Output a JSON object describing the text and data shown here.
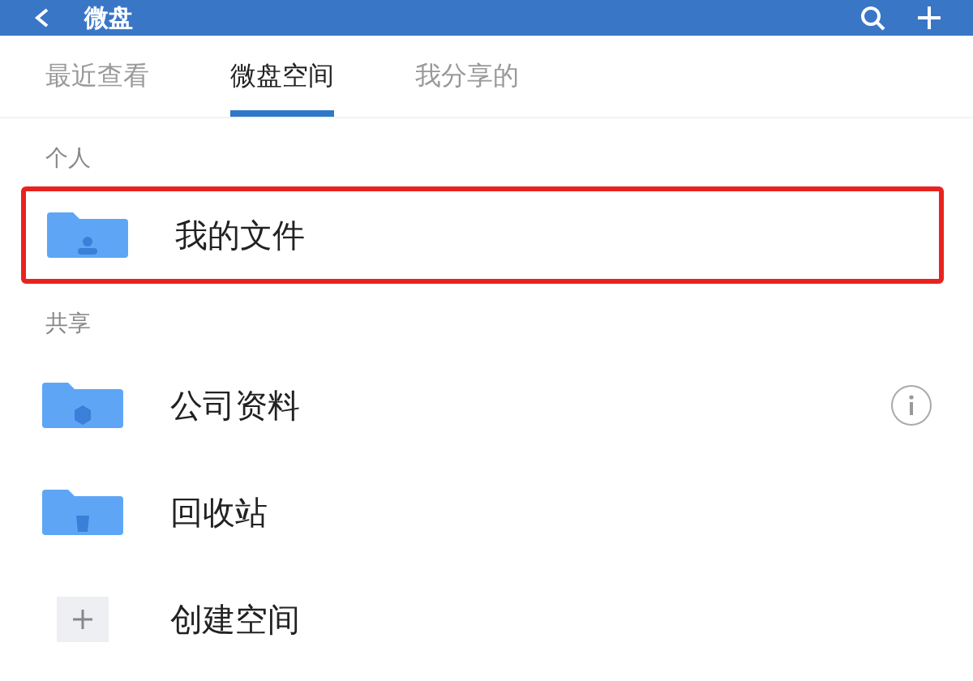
{
  "header": {
    "title": "微盘"
  },
  "tabs": [
    {
      "label": "最近查看",
      "selected": false
    },
    {
      "label": "微盘空间",
      "selected": true
    },
    {
      "label": "我分享的",
      "selected": false
    }
  ],
  "sections": [
    {
      "title": "个人",
      "items": [
        {
          "kind": "personal",
          "label": "我的文件",
          "highlighted": true,
          "info": false
        }
      ]
    },
    {
      "title": "共享",
      "items": [
        {
          "kind": "shared",
          "label": "公司资料",
          "highlighted": false,
          "info": true
        },
        {
          "kind": "trash",
          "label": "回收站",
          "highlighted": false,
          "info": false
        },
        {
          "kind": "add",
          "label": "创建空间",
          "highlighted": false,
          "info": false
        }
      ]
    }
  ]
}
